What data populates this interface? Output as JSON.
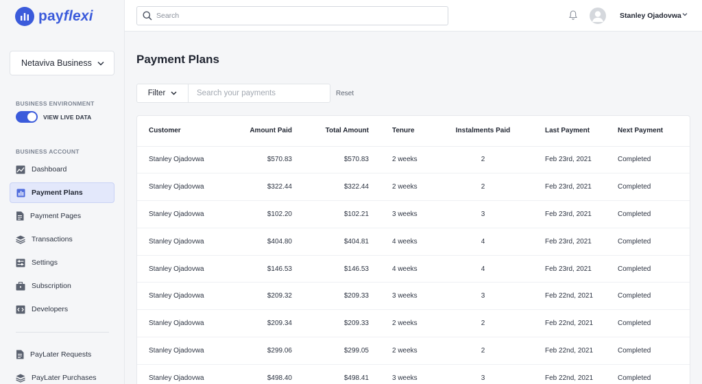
{
  "brand": {
    "name_prefix": "pay",
    "name_suffix": "flexi"
  },
  "business_selector": {
    "selected": "Netaviva Business"
  },
  "environment": {
    "section_label": "BUSINESS ENVIRONMENT",
    "toggle_label": "VIEW LIVE DATA",
    "live": true
  },
  "account_section_label": "BUSINESS ACCOUNT",
  "nav": {
    "items": [
      {
        "label": "Dashboard",
        "icon": "chart-image-icon",
        "active": false
      },
      {
        "label": "Payment Plans",
        "icon": "bar-chart-icon",
        "active": true
      },
      {
        "label": "Payment Pages",
        "icon": "document-icon",
        "active": false
      },
      {
        "label": "Transactions",
        "icon": "layers-icon",
        "active": false
      },
      {
        "label": "Settings",
        "icon": "sliders-icon",
        "active": false
      },
      {
        "label": "Subscription",
        "icon": "briefcase-icon",
        "active": false
      },
      {
        "label": "Developers",
        "icon": "code-icon",
        "active": false
      }
    ],
    "extra_items": [
      {
        "label": "PayLater Requests",
        "icon": "document-icon"
      },
      {
        "label": "PayLater Purchases",
        "icon": "layers-icon"
      }
    ]
  },
  "topbar": {
    "search_placeholder": "Search",
    "user_name": "Stanley Ojadovwa"
  },
  "page": {
    "title": "Payment Plans",
    "filter_label": "Filter",
    "search_placeholder": "Search your payments",
    "reset_label": "Reset"
  },
  "table": {
    "headers": [
      "Customer",
      "Amount Paid",
      "Total Amount",
      "Tenure",
      "Instalments Paid",
      "Last Payment",
      "Next Payment"
    ],
    "rows": [
      [
        "Stanley Ojadovwa",
        "$570.83",
        "$570.83",
        "2 weeks",
        "2",
        "Feb 23rd, 2021",
        "Completed"
      ],
      [
        "Stanley Ojadovwa",
        "$322.44",
        "$322.44",
        "2 weeks",
        "2",
        "Feb 23rd, 2021",
        "Completed"
      ],
      [
        "Stanley Ojadovwa",
        "$102.20",
        "$102.21",
        "3 weeks",
        "3",
        "Feb 23rd, 2021",
        "Completed"
      ],
      [
        "Stanley Ojadovwa",
        "$404.80",
        "$404.81",
        "4 weeks",
        "4",
        "Feb 23rd, 2021",
        "Completed"
      ],
      [
        "Stanley Ojadovwa",
        "$146.53",
        "$146.53",
        "4 weeks",
        "4",
        "Feb 23rd, 2021",
        "Completed"
      ],
      [
        "Stanley Ojadovwa",
        "$209.32",
        "$209.33",
        "3 weeks",
        "3",
        "Feb 22nd, 2021",
        "Completed"
      ],
      [
        "Stanley Ojadovwa",
        "$209.34",
        "$209.33",
        "2 weeks",
        "2",
        "Feb 22nd, 2021",
        "Completed"
      ],
      [
        "Stanley Ojadovwa",
        "$299.06",
        "$299.05",
        "2 weeks",
        "2",
        "Feb 22nd, 2021",
        "Completed"
      ],
      [
        "Stanley Ojadovwa",
        "$498.40",
        "$498.41",
        "3 weeks",
        "3",
        "Feb 22nd, 2021",
        "Completed"
      ]
    ]
  },
  "colors": {
    "accent": "#3b5bdb",
    "active_nav_bg": "#e3e8fb",
    "page_bg": "#f5f6f8"
  }
}
